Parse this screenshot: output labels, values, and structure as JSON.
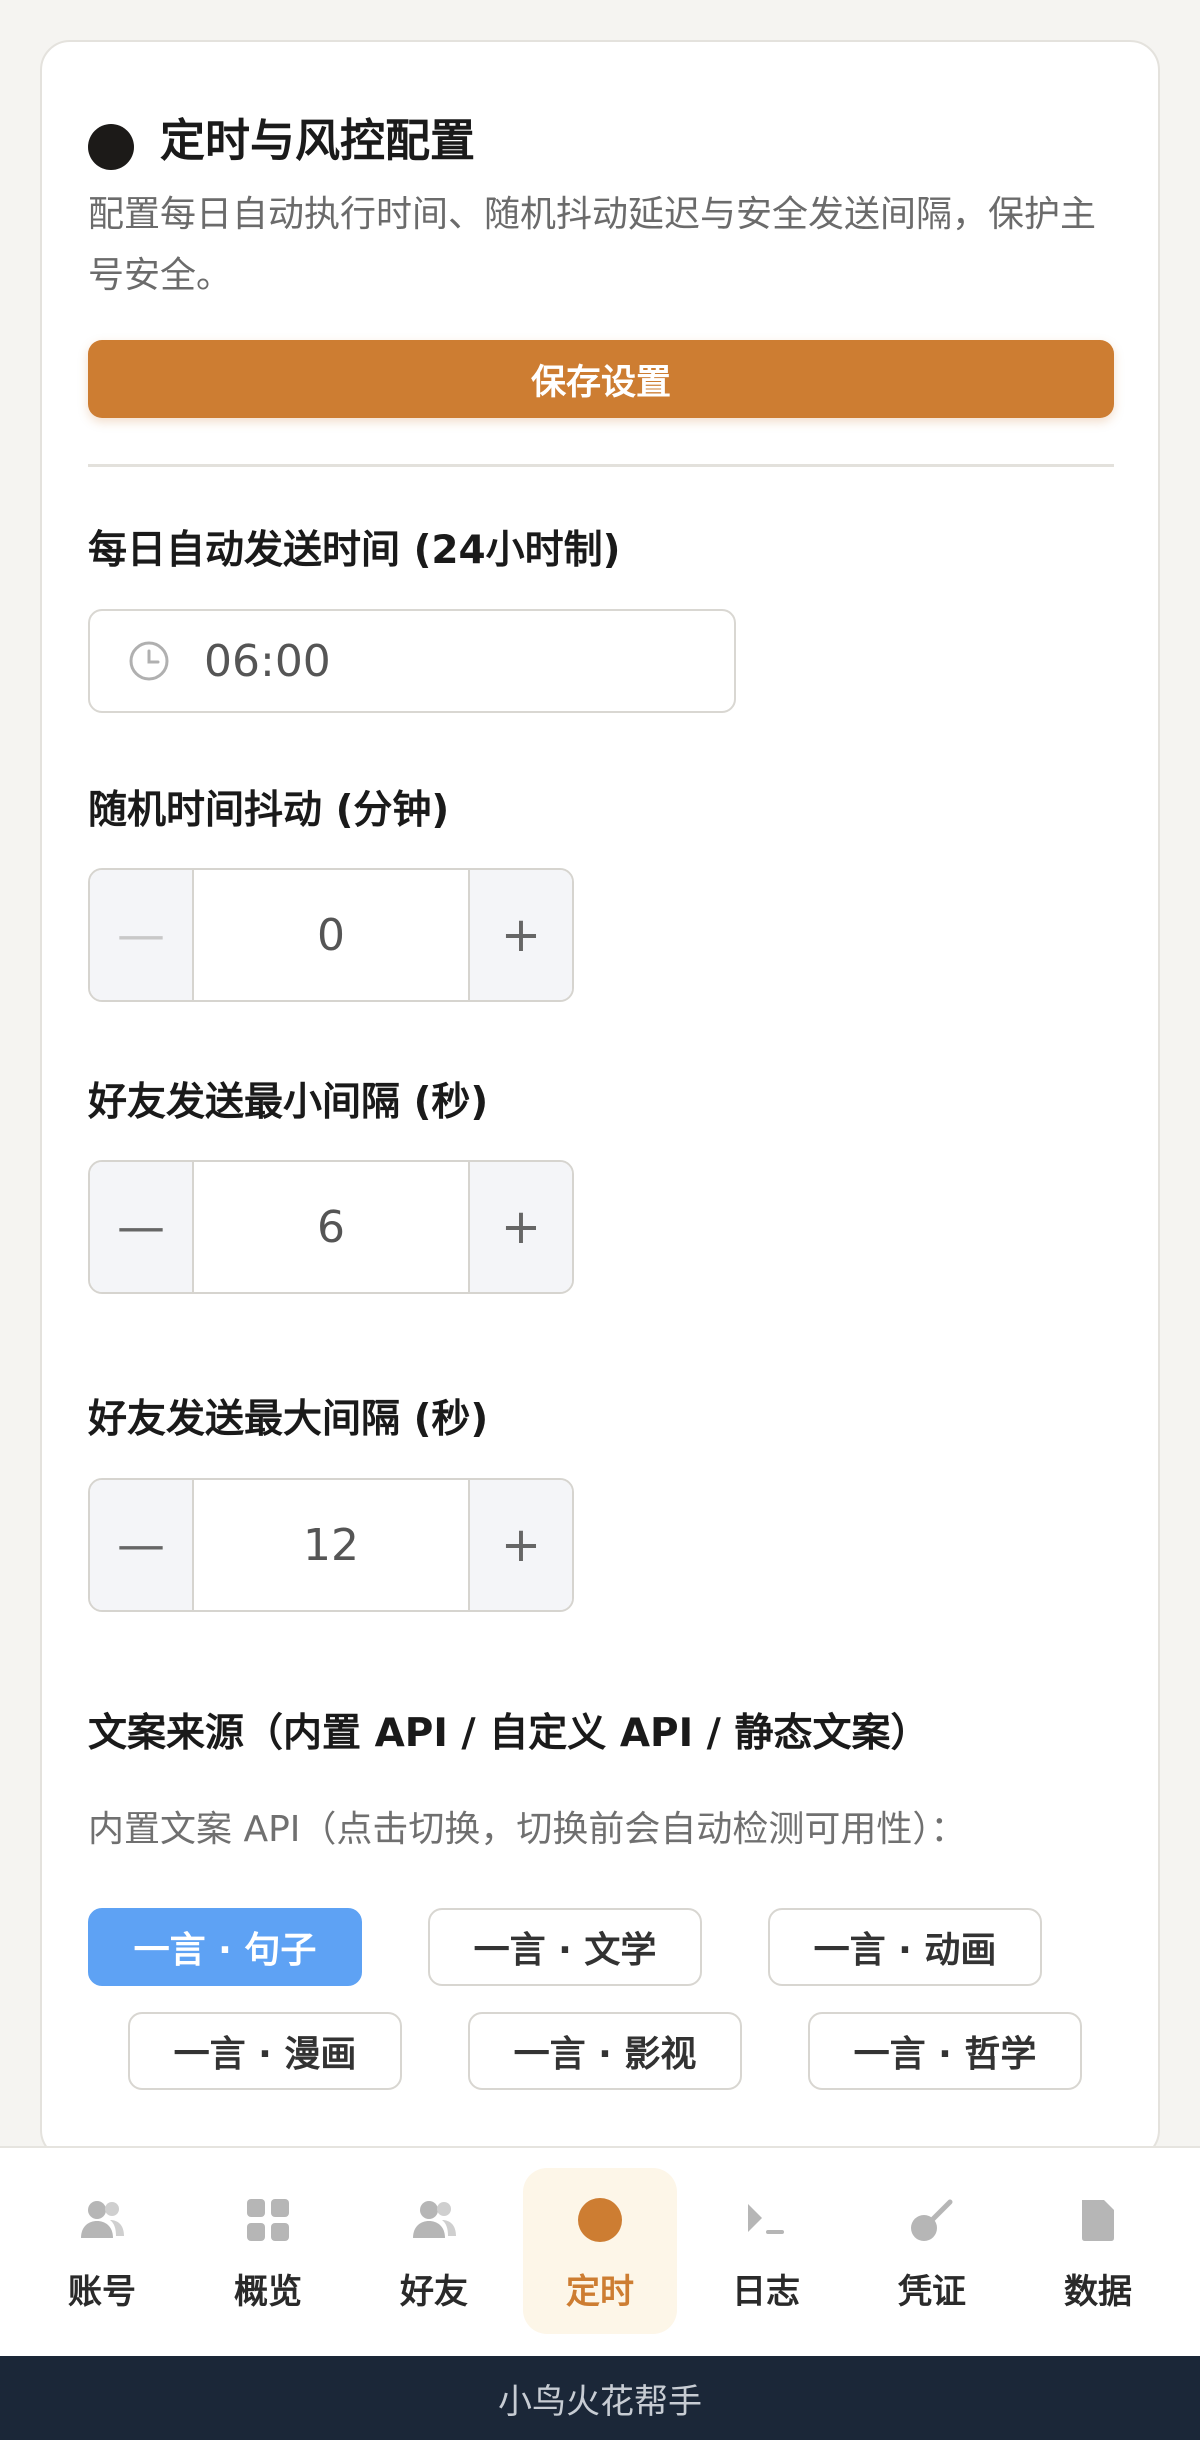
{
  "header": {
    "title": "定时与风控配置",
    "subtitle": "配置每日自动执行时间、随机抖动延迟与安全发送间隔，保护主号安全。"
  },
  "save_button": {
    "label": "保存设置"
  },
  "fields": {
    "daily_time": {
      "label": "每日自动发送时间 (24小时制)",
      "value": "06:00"
    },
    "jitter": {
      "label": "随机时间抖动 (分钟)",
      "value": "0"
    },
    "min_interval": {
      "label": "好友发送最小间隔 (秒)",
      "value": "6"
    },
    "max_interval": {
      "label": "好友发送最大间隔 (秒)",
      "value": "12"
    }
  },
  "stepper_symbols": {
    "minus": "—",
    "plus": "+"
  },
  "copy_source": {
    "label": "文案来源（内置 API / 自定义 API / 静态文案）",
    "hint": "内置文案 API（点击切换，切换前会自动检测可用性）：",
    "chips": [
      {
        "label": "一言 · 句子",
        "active": true
      },
      {
        "label": "一言 · 文学",
        "active": false
      },
      {
        "label": "一言 · 动画",
        "active": false
      },
      {
        "label": "一言 · 漫画",
        "active": false
      },
      {
        "label": "一言 · 影视",
        "active": false
      },
      {
        "label": "一言 · 哲学",
        "active": false
      }
    ]
  },
  "nav": {
    "items": [
      {
        "label": "账号",
        "icon": "users-icon"
      },
      {
        "label": "概览",
        "icon": "grid-icon"
      },
      {
        "label": "好友",
        "icon": "users-icon"
      },
      {
        "label": "定时",
        "icon": "circle-icon",
        "active": true
      },
      {
        "label": "日志",
        "icon": "terminal-icon"
      },
      {
        "label": "凭证",
        "icon": "key-icon"
      },
      {
        "label": "数据",
        "icon": "file-icon"
      }
    ]
  },
  "footer": {
    "text": "小鸟火花帮手"
  },
  "colors": {
    "accent": "#cd7d32",
    "chip_active": "#5ea2f4",
    "footer_bg": "#1b2738"
  }
}
